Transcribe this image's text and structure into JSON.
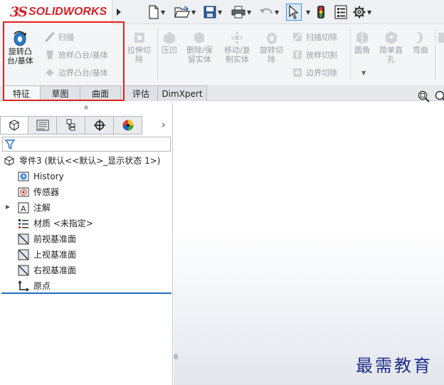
{
  "app": {
    "logo_ds": "3S",
    "logo_solid": "SOLID",
    "logo_works": "WORKS"
  },
  "quick_access": [
    "new-icon",
    "open-icon",
    "save-icon",
    "print-icon",
    "undo-icon",
    "select-icon",
    "rebuild-icon",
    "file-properties-icon",
    "options-icon"
  ],
  "features": {
    "revolve_boss": "旋转凸\n台/基体",
    "sweep": "扫描",
    "loft_boss": "放样凸台/基体",
    "boundary_boss": "边界凸台/基体",
    "extrude_cut": "拉伸切\n除",
    "indent": "压凹",
    "delete_keep_body": "删除/保\n留实体",
    "move_copy_body": "移动/复\n制实体",
    "revolve_cut": "旋转切\n除",
    "swept_cut": "扫描切除",
    "lofted_cut": "放样切割",
    "boundary_cut": "边界切除",
    "fillet": "圆角",
    "simple_hole": "简单直\n孔",
    "bend": "弯曲"
  },
  "tabs": [
    "特征",
    "草图",
    "曲面",
    "评估",
    "DimXpert"
  ],
  "tree": {
    "root": "零件3 (默认<<默认>_显示状态 1>)",
    "items": [
      "History",
      "传感器",
      "注解",
      "材质 <未指定>",
      "前视基准面",
      "上视基准面",
      "右视基准面",
      "原点"
    ]
  },
  "watermark": "最需教育",
  "colors": {
    "brand_red": "#d2232a",
    "highlight_red": "#e02020",
    "accent_blue": "#1f6fbf"
  }
}
